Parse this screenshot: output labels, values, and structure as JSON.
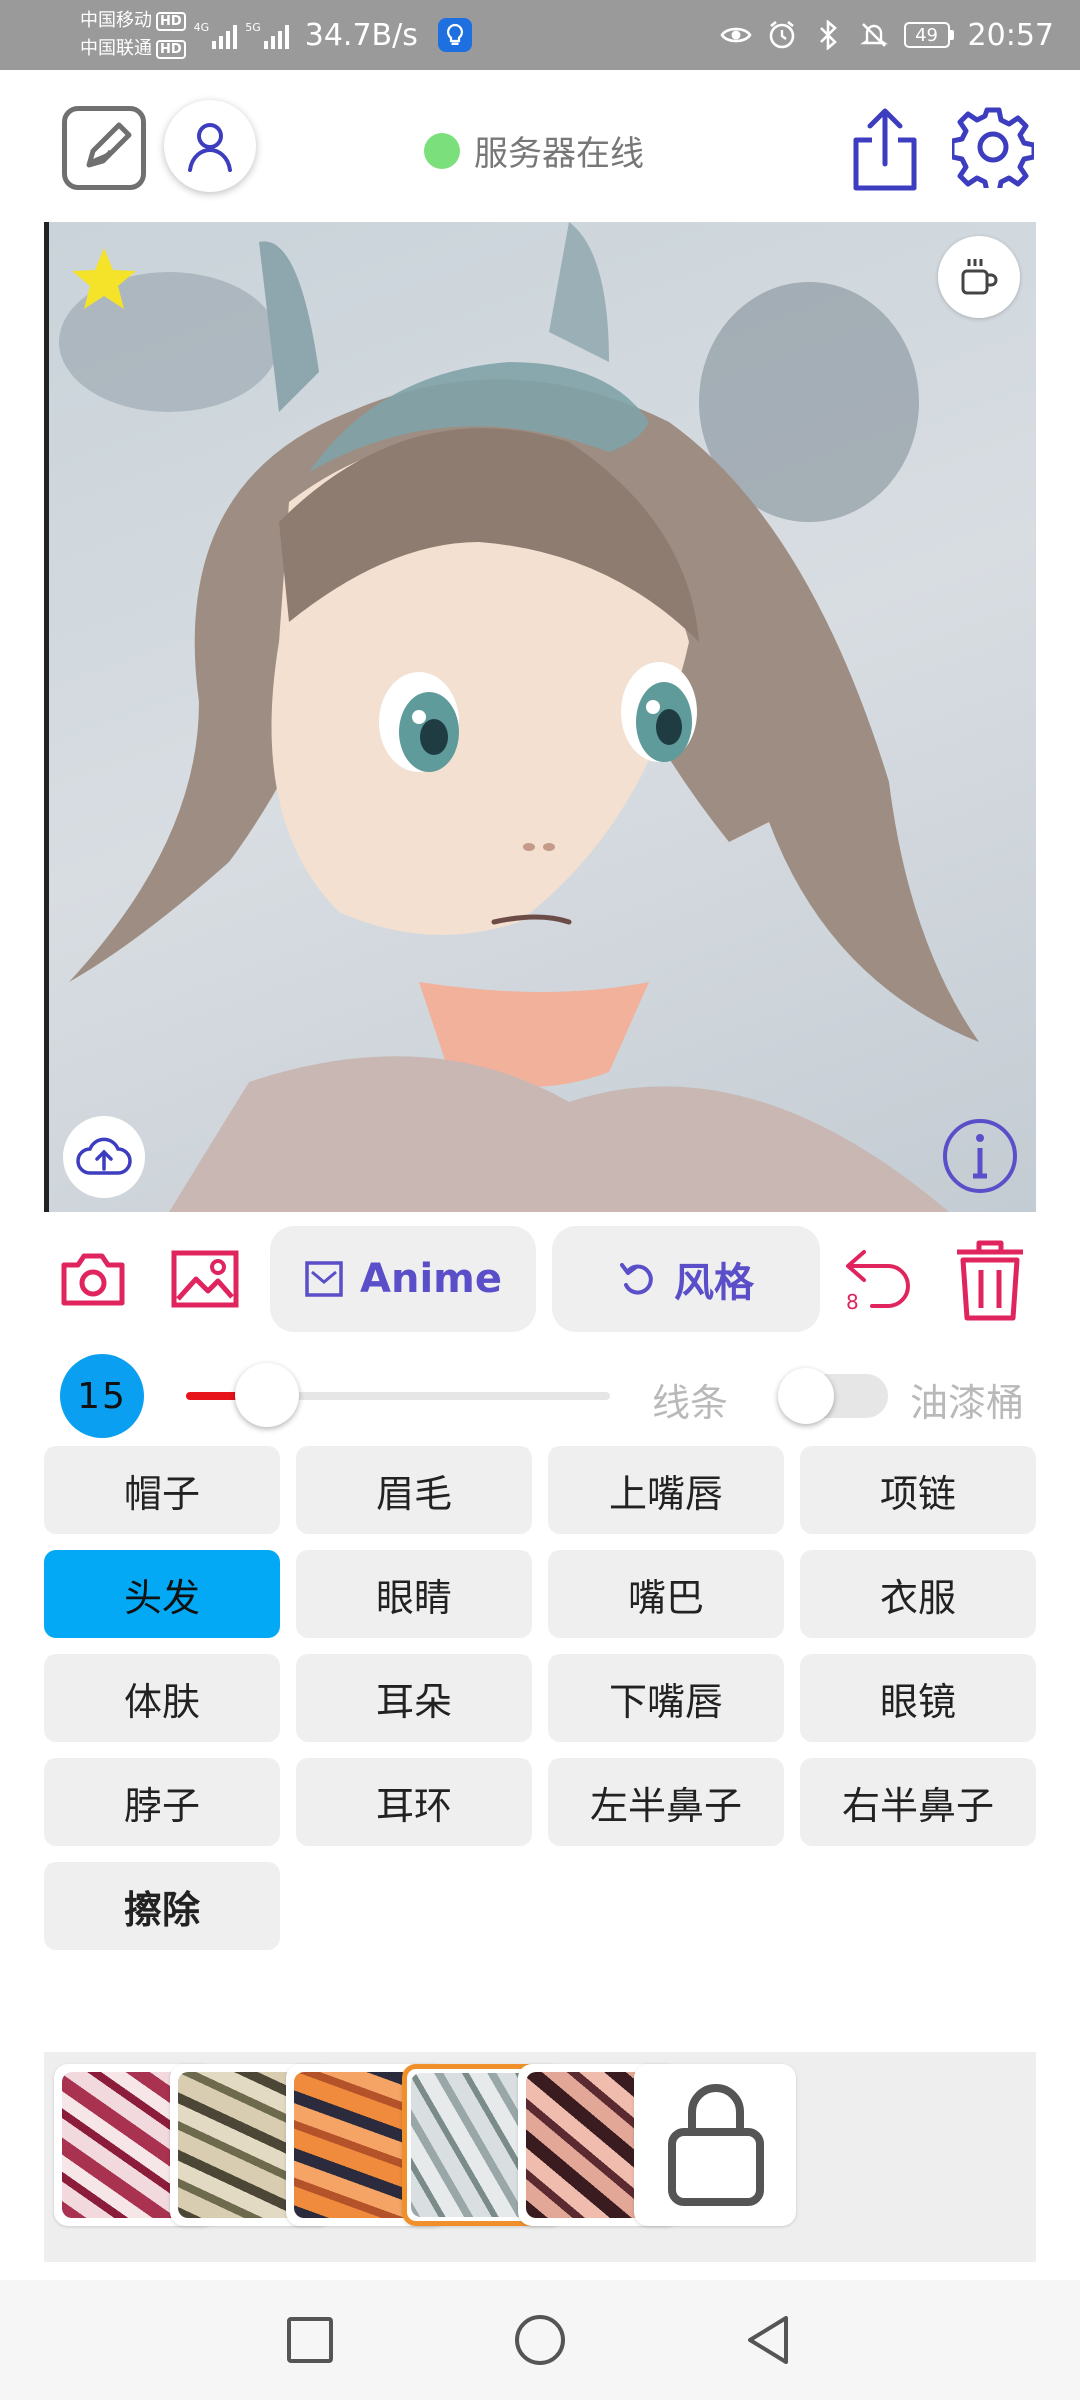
{
  "status_bar": {
    "carrier_1": "中国移动",
    "carrier_2": "中国联通",
    "hd": "HD",
    "network_1": "4G",
    "network_2": "5G",
    "speed": "34.7B/s",
    "battery": "49",
    "time": "20:57"
  },
  "header": {
    "server_status": "服务器在线",
    "server_status_color": "#7be07b"
  },
  "toolbar": {
    "anime_label": "Anime",
    "style_label": "风格",
    "undo_count": "8",
    "accent_color": "#5a4fc9",
    "icon_color": "#e0245e"
  },
  "brush": {
    "size": "15",
    "slider_fraction": 0.19,
    "line_label": "线条",
    "bucket_label": "油漆桶",
    "bucket_enabled": false
  },
  "parts": [
    {
      "label": "帽子",
      "active": false
    },
    {
      "label": "眉毛",
      "active": false
    },
    {
      "label": "上嘴唇",
      "active": false
    },
    {
      "label": "项链",
      "active": false
    },
    {
      "label": "头发",
      "active": true
    },
    {
      "label": "眼睛",
      "active": false
    },
    {
      "label": "嘴巴",
      "active": false
    },
    {
      "label": "衣服",
      "active": false
    },
    {
      "label": "体肤",
      "active": false
    },
    {
      "label": "耳朵",
      "active": false
    },
    {
      "label": "下嘴唇",
      "active": false
    },
    {
      "label": "眼镜",
      "active": false
    },
    {
      "label": "脖子",
      "active": false
    },
    {
      "label": "耳环",
      "active": false
    },
    {
      "label": "左半鼻子",
      "active": false
    },
    {
      "label": "右半鼻子",
      "active": false
    },
    {
      "label": "擦除",
      "active": false
    }
  ],
  "styles": [
    {
      "name": "style-thumb-1",
      "selected": false
    },
    {
      "name": "style-thumb-2",
      "selected": false
    },
    {
      "name": "style-thumb-3",
      "selected": false
    },
    {
      "name": "style-thumb-4",
      "selected": true
    },
    {
      "name": "style-thumb-5",
      "selected": false
    },
    {
      "name": "style-thumb-locked",
      "selected": false
    }
  ]
}
